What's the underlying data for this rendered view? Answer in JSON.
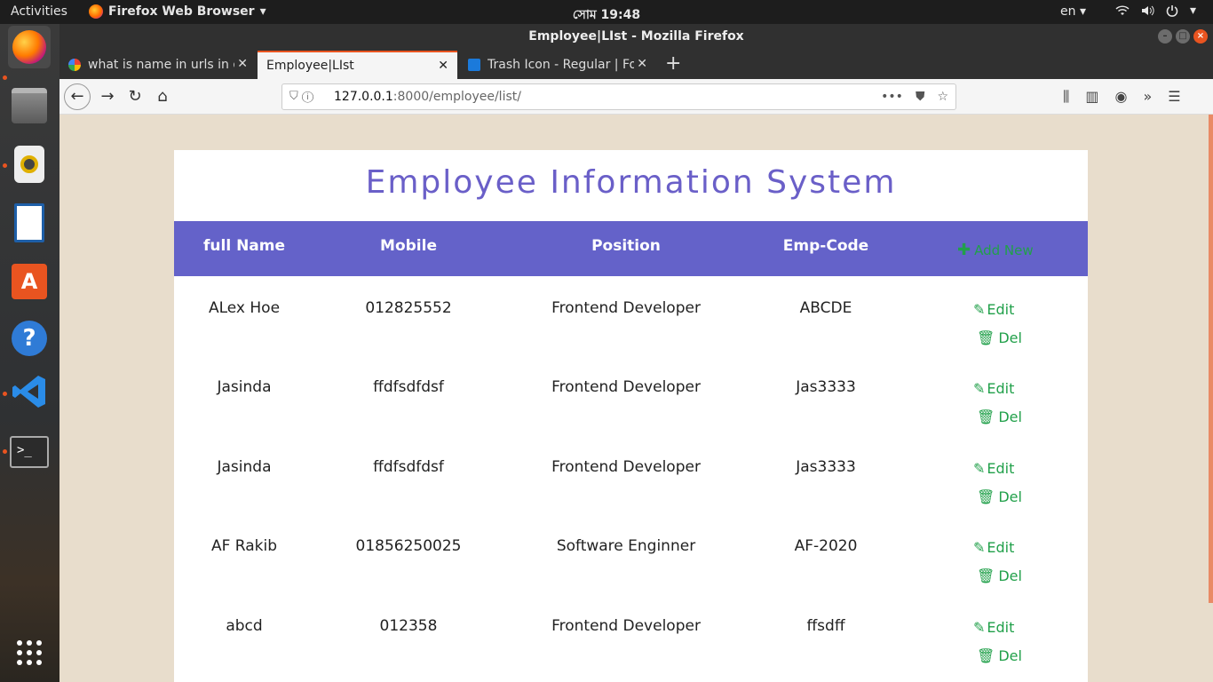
{
  "topbar": {
    "activities": "Activities",
    "app_name": "Firefox Web Browser",
    "clock": "সোম 19:48",
    "lang": "en"
  },
  "window": {
    "title": "Employee|LIst - Mozilla Firefox"
  },
  "tabs": [
    {
      "label": "what is name in urls in dj"
    },
    {
      "label": "Employee|LIst"
    },
    {
      "label": "Trash Icon - Regular | For"
    }
  ],
  "urlbar": {
    "host": "127.0.0.1",
    "path": ":8000/employee/list/"
  },
  "page": {
    "heading": "Employee Information System",
    "columns": {
      "full_name": "full Name",
      "mobile": "Mobile",
      "position": "Position",
      "emp_code": "Emp-Code",
      "add_new": "Add New"
    },
    "edit_label": "Edit",
    "del_label": "Del",
    "rows": [
      {
        "name": "ALex Hoe",
        "mobile": "012825552",
        "position": "Frontend Developer",
        "code": "ABCDE"
      },
      {
        "name": "Jasinda",
        "mobile": "ffdfsdfdsf",
        "position": "Frontend Developer",
        "code": "Jas3333"
      },
      {
        "name": "Jasinda",
        "mobile": "ffdfsdfdsf",
        "position": "Frontend Developer",
        "code": "Jas3333"
      },
      {
        "name": "AF Rakib",
        "mobile": "01856250025",
        "position": "Software Enginner",
        "code": "AF-2020"
      },
      {
        "name": "abcd",
        "mobile": "012358",
        "position": "Frontend Developer",
        "code": "ffsdff"
      }
    ]
  },
  "colors": {
    "accent": "#6462c9",
    "action_green": "#21a04a",
    "page_bg": "#e8ddcc"
  }
}
